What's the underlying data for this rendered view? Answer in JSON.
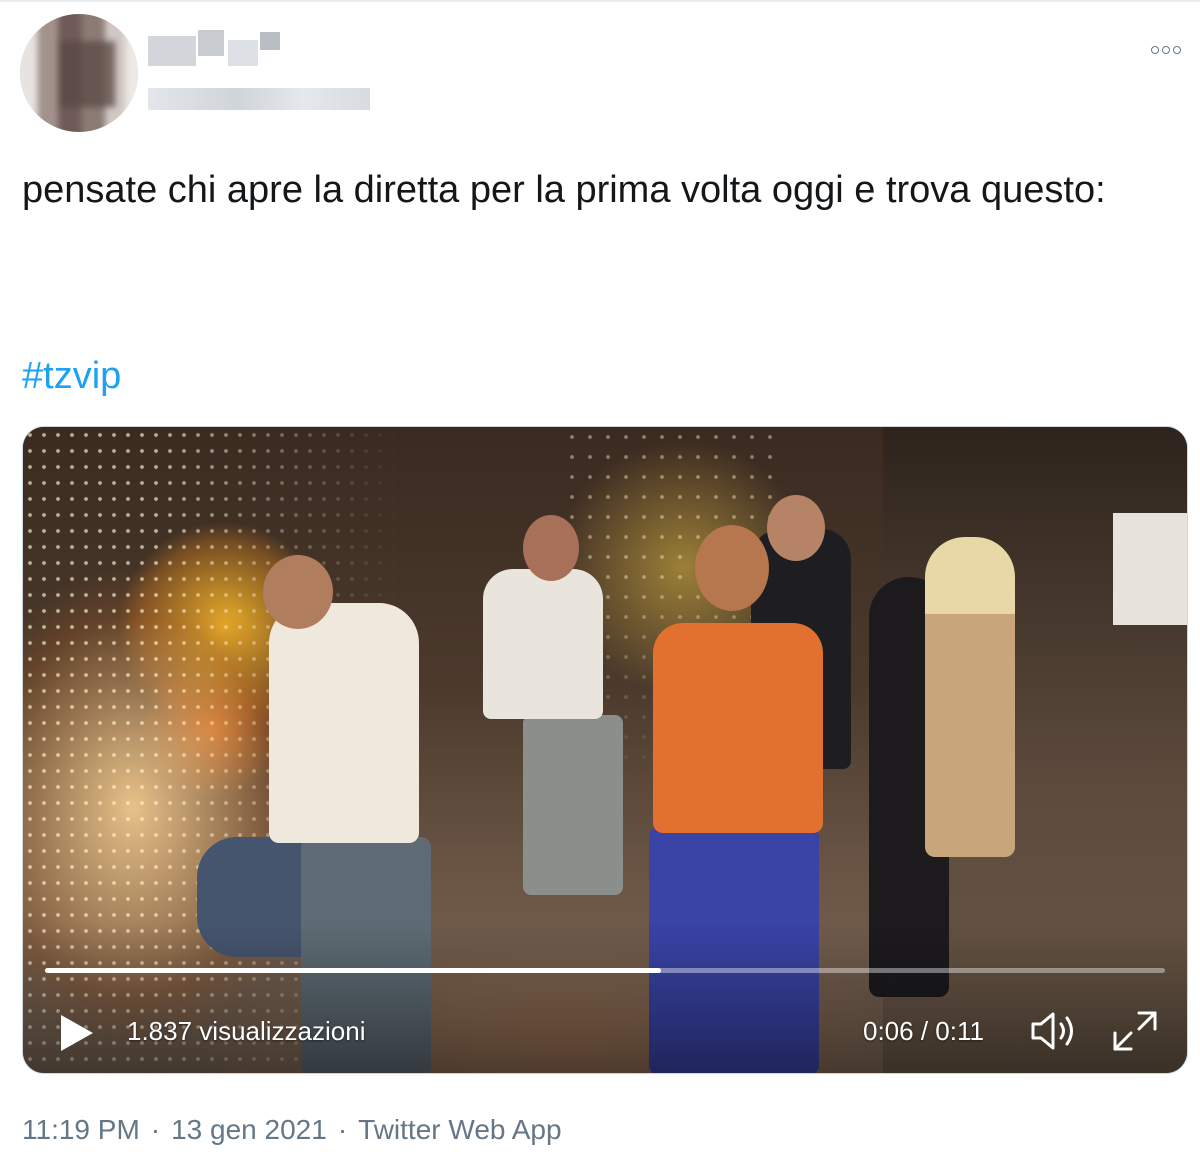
{
  "tweet": {
    "text": "pensate chi apre la diretta per la prima volta oggi e trova questo:",
    "hashtag": "#tzvip",
    "more_icon": "more-icon"
  },
  "video": {
    "views": "1.837 visualizzazioni",
    "time": "0:06 / 0:11",
    "progress": 0.55,
    "play_icon": "play-icon",
    "volume_icon": "volume-icon",
    "fullscreen_icon": "fullscreen-icon"
  },
  "footer": {
    "time": "11:19 PM",
    "separator": "·",
    "date": "13 gen 2021",
    "source": "Twitter Web App"
  },
  "colors": {
    "link": "#1da1f2",
    "meta": "#657786",
    "text": "#14171a"
  }
}
